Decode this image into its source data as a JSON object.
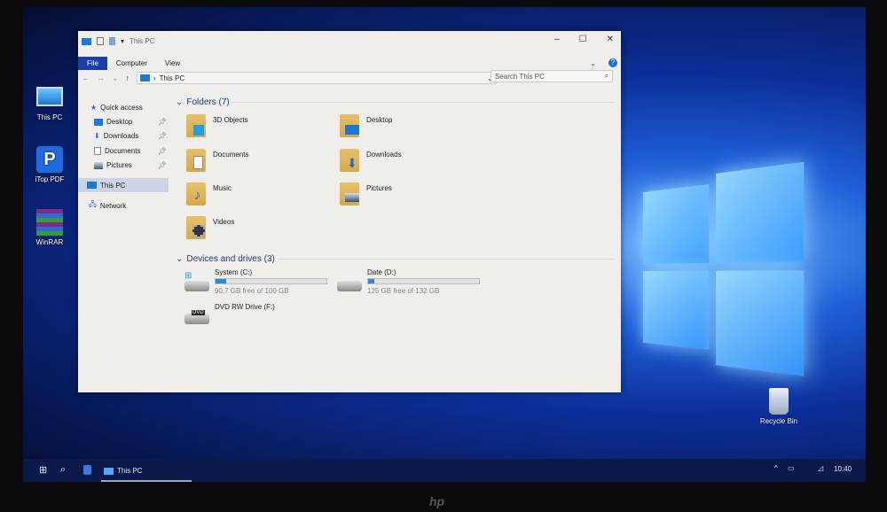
{
  "desktop": {
    "icons": [
      {
        "label": "This PC"
      },
      {
        "label": "iTop PDF"
      },
      {
        "label": "WinRAR"
      },
      {
        "label": "Recycle Bin"
      }
    ]
  },
  "window": {
    "title": "This PC",
    "ribbon_tabs": [
      "File",
      "Computer",
      "View"
    ],
    "address": "This PC",
    "search_placeholder": "Search This PC",
    "nav": {
      "quick_access": "Quick access",
      "pinned": [
        "Desktop",
        "Downloads",
        "Documents",
        "Pictures"
      ],
      "this_pc": "This PC",
      "network": "Network"
    },
    "folders_header": "Folders (7)",
    "folders": [
      "3D Objects",
      "Desktop",
      "Documents",
      "Downloads",
      "Music",
      "Pictures",
      "Videos"
    ],
    "drives_header": "Devices and drives (3)",
    "drives": [
      {
        "name": "System (C:)",
        "info": "90,7 GB free of 100 GB",
        "used_percent": 9.3
      },
      {
        "name": "Date (D:)",
        "info": "125 GB free of 132 GB",
        "used_percent": 5.3
      },
      {
        "name": "DVD RW Drive (F:)",
        "badge": "DVD"
      }
    ]
  },
  "taskbar": {
    "app": "This PC",
    "time": "10:40"
  },
  "bezel": {
    "brand": "hp"
  },
  "colors": {
    "accent": "#2b8ad8",
    "file_tab": "#1a3fa8"
  }
}
